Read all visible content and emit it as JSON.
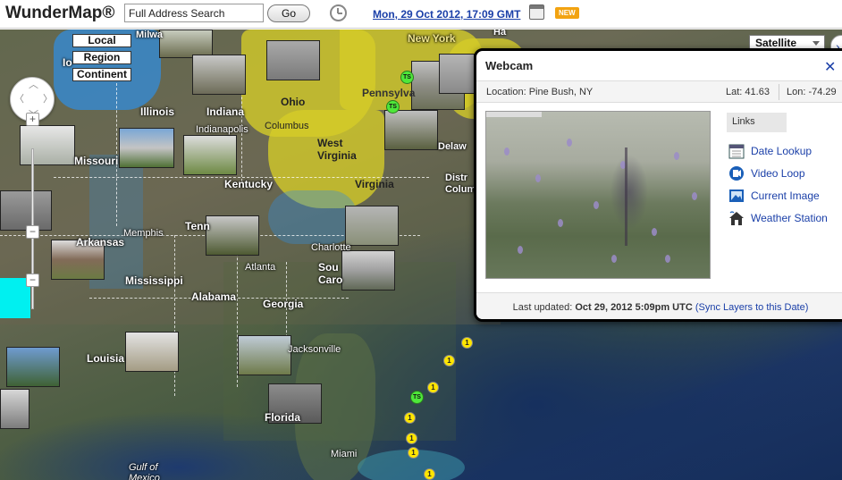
{
  "header": {
    "logo": "WunderMap®",
    "search_value": "Full Address Search",
    "go_label": "Go",
    "date_time": "Mon, 29 Oct 2012, 17:09 GMT",
    "new_badge": "NEW"
  },
  "map": {
    "scale_buttons": [
      "Local",
      "Region",
      "Continent"
    ],
    "zoom_in": "+",
    "zoom_out": "−",
    "layer_select": "Satellite",
    "state_labels": [
      "New York",
      "Ohio",
      "Illinois",
      "Indiana",
      "West Virginia",
      "Pennsylva",
      "Missouri",
      "Kentucky",
      "Virginia",
      "Tenn",
      "Arkansas",
      "Mississippi",
      "Alabama",
      "Georgia",
      "Louisia",
      "Sou Caro",
      "Florida",
      "Io",
      "Milwa",
      "Ha",
      "Delaw",
      "Distr Colum"
    ],
    "city_labels": [
      "Columbus",
      "Indianapolis",
      "Memphis",
      "Atlanta",
      "Charlotte",
      "Jacksonville",
      "Miami",
      "Gulf of Mexico"
    ],
    "storm_markers": [
      "TS",
      "TS",
      "1",
      "1",
      "1",
      "1",
      "1",
      "1",
      "1",
      "TS"
    ]
  },
  "popup": {
    "title": "Webcam",
    "close": "✕",
    "location": "Location: Pine Bush, NY",
    "lat": "Lat: 41.63",
    "lon": "Lon: -74.29",
    "links_heading": "Links",
    "links": [
      "Date Lookup",
      "Video Loop",
      "Current Image",
      "Weather Station"
    ],
    "footer_prefix": "Last updated: ",
    "footer_time": "Oct 29, 2012 5:09pm UTC",
    "footer_link": "(Sync Layers to this Date)"
  },
  "colors": {
    "link": "#1a3fa8",
    "radar_yellow": "#d6cd28",
    "new_badge": "#f2a311",
    "tropical_storm": "#4ee83a",
    "hurricane": "#ffe600"
  }
}
